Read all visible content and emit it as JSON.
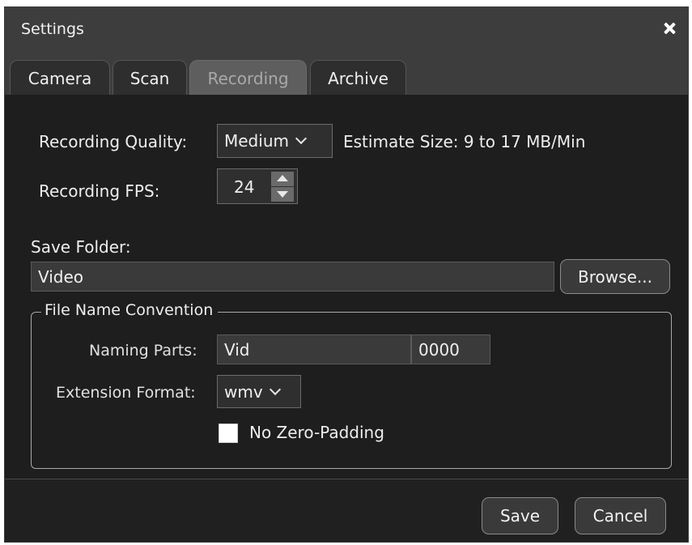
{
  "window": {
    "title": "Settings"
  },
  "tabs": [
    {
      "label": "Camera",
      "active": false
    },
    {
      "label": "Scan",
      "active": false
    },
    {
      "label": "Recording",
      "active": true
    },
    {
      "label": "Archive",
      "active": false
    }
  ],
  "recording": {
    "quality_label": "Recording Quality:",
    "quality_value": "Medium",
    "estimate_label": "Estimate Size: 9 to 17 MB/Min",
    "fps_label": "Recording FPS:",
    "fps_value": "24"
  },
  "save_folder": {
    "label": "Save Folder:",
    "value": "Video",
    "browse_label": "Browse..."
  },
  "file_name_convention": {
    "legend": "File Name Convention",
    "naming_parts_label": "Naming Parts:",
    "naming_prefix": "Vid",
    "naming_number": "0000",
    "extension_label": "Extension Format:",
    "extension_value": "wmv",
    "no_zero_padding_label": "No Zero-Padding",
    "no_zero_padding_checked": false
  },
  "footer": {
    "save_label": "Save",
    "cancel_label": "Cancel"
  },
  "colors": {
    "background": "#1e1e1e",
    "titlebar": "#3d3d3d",
    "active_tab": "#5e5e5e"
  }
}
